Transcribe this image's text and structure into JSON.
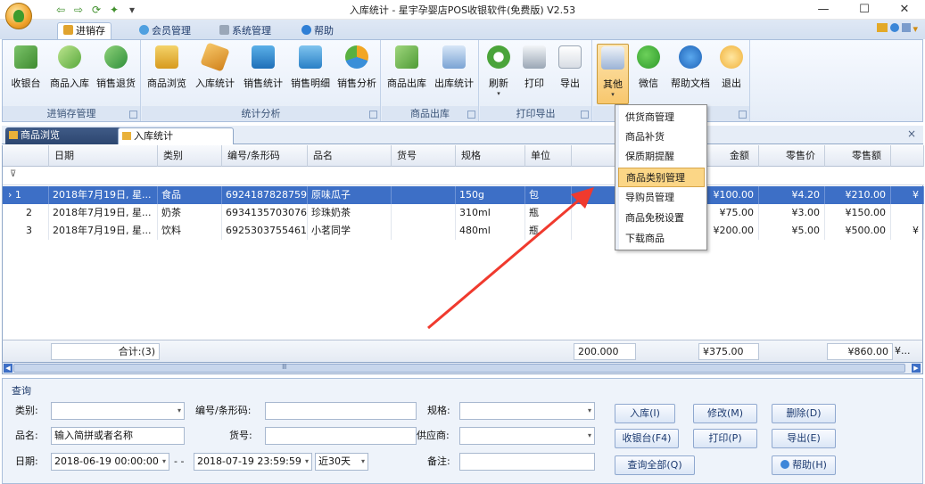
{
  "window": {
    "title": "入库统计 - 星宇孕婴店POS收银软件(免费版) V2.53",
    "min_glyph": "—",
    "max_glyph": "☐",
    "close_glyph": "✕"
  },
  "qat": {
    "back": "⇦",
    "forward": "⇨",
    "refresh": "⟳",
    "settings": "✦",
    "more": "▾"
  },
  "ribbon": {
    "tabs": [
      {
        "label": "进销存",
        "icon": "box-icon"
      },
      {
        "label": "会员管理",
        "icon": "members-icon"
      },
      {
        "label": "系统管理",
        "icon": "wrench-icon"
      },
      {
        "label": "帮助",
        "icon": "help-icon"
      }
    ],
    "right_icons": "▾",
    "groups": [
      {
        "label": "进销存管理",
        "buttons": [
          "收银台",
          "商品入库",
          "销售退货"
        ]
      },
      {
        "label": "统计分析",
        "buttons": [
          "商品浏览",
          "入库统计",
          "销售统计",
          "销售明细",
          "销售分析"
        ]
      },
      {
        "label": "商品出库",
        "buttons": [
          "商品出库",
          "出库统计"
        ]
      },
      {
        "label": "打印导出",
        "buttons": [
          "刷新",
          "打印",
          "导出"
        ]
      },
      {
        "label": "",
        "buttons": [
          "其他",
          "微信",
          "帮助文档",
          "退出"
        ]
      }
    ],
    "launcher": "↘",
    "dropdown_glyph": "▾"
  },
  "doc_tabs": [
    {
      "label": "商品浏览"
    },
    {
      "label": "入库统计"
    }
  ],
  "doc_close": "×",
  "grid": {
    "columns": [
      "日期",
      "类别",
      "编号/条形码",
      "品名",
      "货号",
      "规格",
      "单位",
      "金额",
      "零售价",
      "零售额"
    ],
    "filter_icon": "⊽",
    "rows": [
      {
        "marker": "› 1",
        "date": "2018年7月19日, 星...",
        "category": "食品",
        "code": "6924187828759",
        "name": "原味瓜子",
        "sku": "",
        "spec": "150g",
        "unit": "包",
        "amount": "¥100.00",
        "retail_price": "¥4.20",
        "retail_total": "¥210.00",
        "extra": "¥"
      },
      {
        "marker": "2",
        "date": "2018年7月19日, 星...",
        "category": "奶茶",
        "code": "6934135703076",
        "name": "珍珠奶茶",
        "sku": "",
        "spec": "310ml",
        "unit": "瓶",
        "amount": "¥75.00",
        "retail_price": "¥3.00",
        "retail_total": "¥150.00",
        "extra": ""
      },
      {
        "marker": "3",
        "date": "2018年7月19日, 星...",
        "category": "饮料",
        "code": "6925303755461",
        "name": "小茗同学",
        "sku": "",
        "spec": "480ml",
        "unit": "瓶",
        "amount": "¥200.00",
        "retail_price": "¥5.00",
        "retail_total": "¥500.00",
        "extra": "¥"
      }
    ],
    "totals": {
      "count": "合计:(3)",
      "quantity": "200.000",
      "amount": "¥375.00",
      "retail_total": "¥860.00",
      "extra": "¥..."
    }
  },
  "scroll": {
    "left": "◀",
    "right": "▶",
    "grip": "Ⅲ"
  },
  "query": {
    "title": "查询",
    "category_label": "类别:",
    "category_value": "",
    "code_label": "编号/条形码:",
    "code_value": "",
    "spec_label": "规格:",
    "spec_value": "",
    "name_label": "品名:",
    "name_placeholder": "输入简拼或者名称",
    "sku_label": "货号:",
    "sku_value": "",
    "supplier_label": "供应商:",
    "supplier_value": "",
    "date_label": "日期:",
    "date_from": "2018-06-19 00:00:00",
    "date_sep": "- -",
    "date_to": "2018-07-19 23:59:59",
    "range": "近30天",
    "note_label": "备注:",
    "note_value": "",
    "buttons": {
      "in": "入库(I)",
      "edit": "修改(M)",
      "delete": "删除(D)",
      "cashier": "收银台(F4)",
      "print": "打印(P)",
      "export": "导出(E)",
      "query_all": "查询全部(Q)",
      "help": "帮助(H)"
    }
  },
  "menu": {
    "items": [
      "供货商管理",
      "商品补货",
      "保质期提醒",
      "商品类别管理",
      "导购员管理",
      "商品免税设置",
      "下载商品"
    ],
    "highlighted_index": 3
  },
  "colors": {
    "accent": "#3d6fc6",
    "arrow": "#f03a2e",
    "menu_highlight": "#fbd686"
  }
}
